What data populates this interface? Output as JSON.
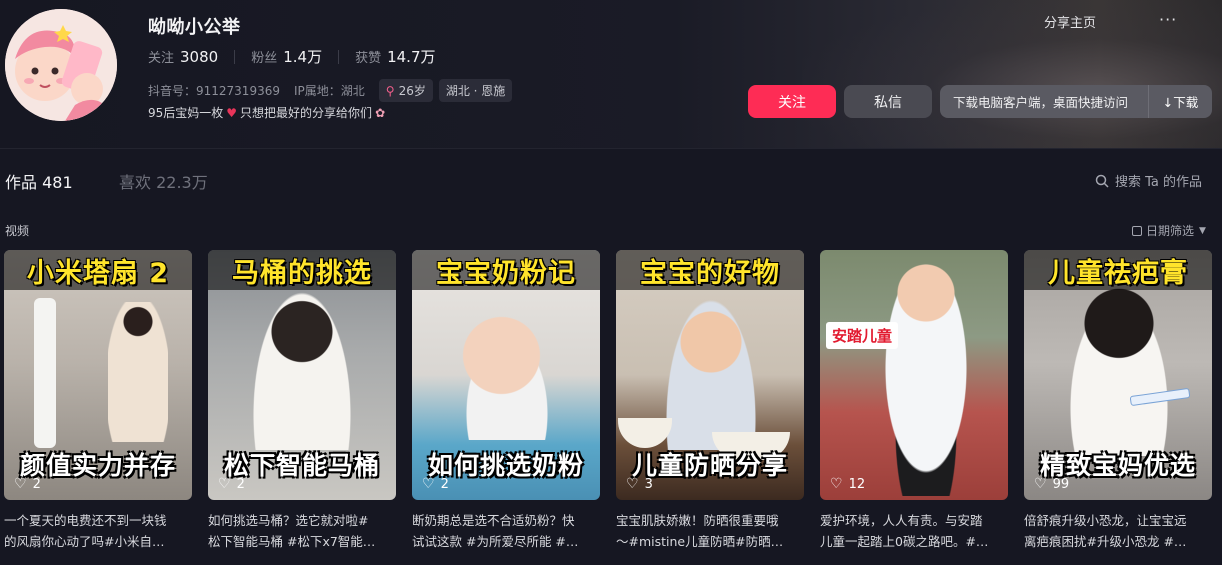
{
  "profile": {
    "nickname": "呦呦小公举",
    "stats": [
      {
        "label": "关注",
        "value": "3080"
      },
      {
        "label": "粉丝",
        "value": "1.4万"
      },
      {
        "label": "获赞",
        "value": "14.7万"
      }
    ],
    "douyin_id": "抖音号：91127319369",
    "ip_location": "IP属地：湖北",
    "age": "26岁",
    "region": "湖北 · 恩施",
    "bio_before": "95后宝妈一枚",
    "bio_after": " 只想把最好的分享给你们"
  },
  "actions": {
    "share_home": "分享主页",
    "more": "···",
    "follow": "关注",
    "message": "私信",
    "download_prompt": "下载电脑客户端，桌面快捷访问",
    "download_button": "↓下载"
  },
  "tabs": {
    "works": "作品 481",
    "likes": "喜欢 22.3万",
    "search_placeholder": "搜索 Ta 的作品"
  },
  "section": {
    "label": "视频",
    "date_filter": "日期筛选"
  },
  "videos": [
    {
      "top": "小米塔扇 2",
      "bottom": "颜值实力并存",
      "likes": "2",
      "caption1": "一个夏天的电费还不到一块钱",
      "caption2": "的风扇你心动了吗#小米自…"
    },
    {
      "top": "马桶的挑选",
      "bottom": "松下智能马桶",
      "likes": "2",
      "caption1": "如何挑选马桶？选它就对啦#",
      "caption2": "松下智能马桶 #松下x7智能…"
    },
    {
      "top": "宝宝奶粉记",
      "bottom": "如何挑选奶粉",
      "likes": "2",
      "caption1": "断奶期总是选不合适奶粉？快",
      "caption2": "试试这款 #为所爱尽所能 #…"
    },
    {
      "top": "宝宝的好物",
      "bottom": "儿童防晒分享",
      "likes": "3",
      "caption1": "宝宝肌肤娇嫩！防晒很重要哦",
      "caption2": "～#mistine儿童防晒#防晒…"
    },
    {
      "top": "",
      "bottom": "",
      "badge": "安踏儿童",
      "likes": "12",
      "caption1": "爱护环境，人人有责。与安踏",
      "caption2": "儿童一起踏上0碳之路吧。#…"
    },
    {
      "top": "儿童祛疤膏",
      "bottom": "精致宝妈优选",
      "likes": "99",
      "caption1": "倍舒痕升级小恐龙，让宝宝远",
      "caption2": "离疤痕困扰#升级小恐龙 #…"
    }
  ]
}
